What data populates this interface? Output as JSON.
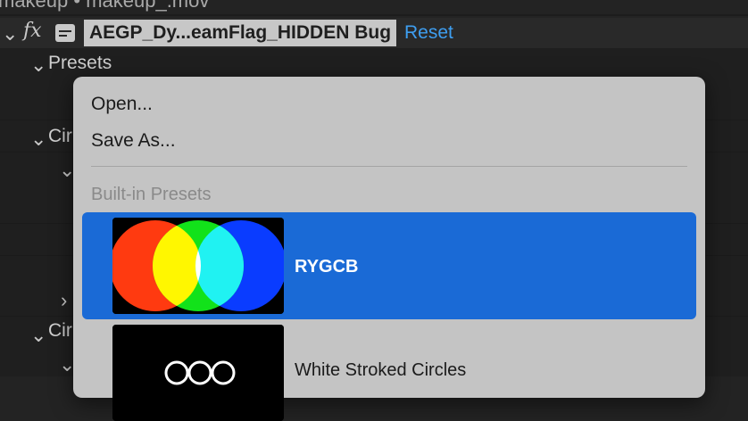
{
  "window": {
    "title": "makeup • makeup_.mov"
  },
  "effect": {
    "fx_glyph": "fx",
    "name": "AEGP_Dy...eamFlag_HIDDEN Bug",
    "reset_label": "Reset"
  },
  "tree": {
    "presets_label": "Presets",
    "circle_label_1": "Cir",
    "circle_label_2": "Cir"
  },
  "menu": {
    "open_label": "Open...",
    "save_as_label": "Save As...",
    "section_label": "Built-in Presets",
    "presets": [
      {
        "name": "RYGCB",
        "selected": true,
        "thumb": "rygcb-circles"
      },
      {
        "name": "White Stroked Circles",
        "selected": false,
        "thumb": "white-stroked-circles"
      }
    ]
  },
  "colors": {
    "accent": "#1a6ad6",
    "link": "#3e9ef0",
    "menu_bg": "#c4c4c4",
    "panel_bg": "#232323"
  },
  "icons": {
    "twirl": "chevron-down-icon",
    "fx": "fx-icon",
    "effect": "effect-icon"
  }
}
